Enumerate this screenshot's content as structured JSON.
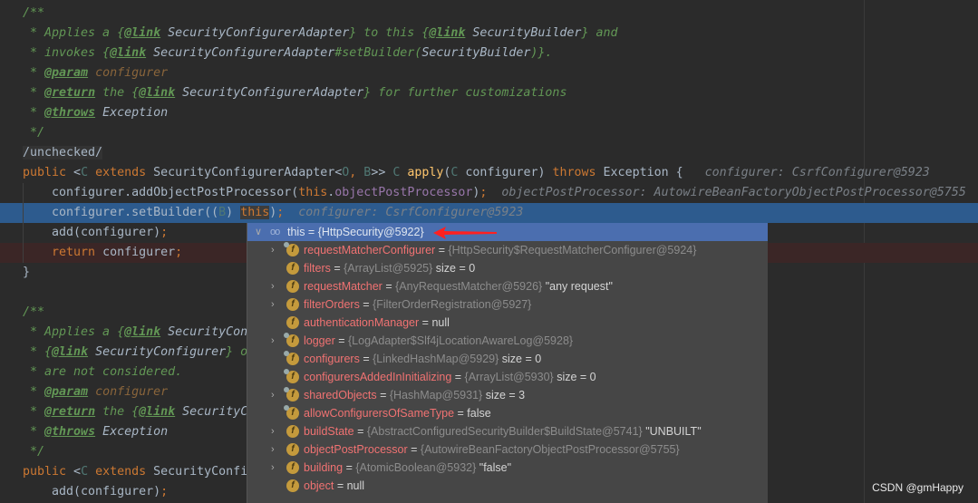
{
  "editor": {
    "lines": [
      [
        {
          "t": "/**",
          "c": "cm"
        }
      ],
      [
        {
          "t": " * Applies a {",
          "c": "cm"
        },
        {
          "t": "@link",
          "c": "tag"
        },
        {
          "t": " SecurityConfigurerAdapter",
          "c": "ref"
        },
        {
          "t": "} to this {",
          "c": "cm"
        },
        {
          "t": "@link",
          "c": "tag"
        },
        {
          "t": " SecurityBuilder",
          "c": "ref"
        },
        {
          "t": "} and",
          "c": "cm"
        }
      ],
      [
        {
          "t": " * invokes {",
          "c": "cm"
        },
        {
          "t": "@link",
          "c": "tag"
        },
        {
          "t": " SecurityConfigurerAdapter",
          "c": "ref"
        },
        {
          "t": "#setBuilder(",
          "c": "cm"
        },
        {
          "t": "SecurityBuilder",
          "c": "ref"
        },
        {
          "t": ")}.",
          "c": "cm"
        }
      ],
      [
        {
          "t": " * ",
          "c": "cm"
        },
        {
          "t": "@param",
          "c": "tag"
        },
        {
          "t": " configurer",
          "c": "pn"
        }
      ],
      [
        {
          "t": " * ",
          "c": "cm"
        },
        {
          "t": "@return",
          "c": "tag"
        },
        {
          "t": " the {",
          "c": "cm"
        },
        {
          "t": "@link",
          "c": "tag"
        },
        {
          "t": " SecurityConfigurerAdapter",
          "c": "ref"
        },
        {
          "t": "} for further customizations",
          "c": "cm"
        }
      ],
      [
        {
          "t": " * ",
          "c": "cm"
        },
        {
          "t": "@throws",
          "c": "tag"
        },
        {
          "t": " Exception",
          "c": "ref"
        }
      ],
      [
        {
          "t": " */",
          "c": "cm"
        }
      ],
      [
        {
          "t": "/unchecked/",
          "c": "unk"
        }
      ],
      [
        {
          "t": "public ",
          "c": "kw"
        },
        {
          "t": "<",
          "c": "pl"
        },
        {
          "t": "C ",
          "c": "ty"
        },
        {
          "t": "extends ",
          "c": "kw"
        },
        {
          "t": "SecurityConfigurerAdapter<",
          "c": "pl"
        },
        {
          "t": "O",
          "c": "ty"
        },
        {
          "t": ", ",
          "c": "kw"
        },
        {
          "t": "B",
          "c": "ty"
        },
        {
          "t": ">> ",
          "c": "pl"
        },
        {
          "t": "C ",
          "c": "ty"
        },
        {
          "t": "apply",
          "c": "fn"
        },
        {
          "t": "(",
          "c": "pl"
        },
        {
          "t": "C ",
          "c": "ty"
        },
        {
          "t": "configurer) ",
          "c": "pl"
        },
        {
          "t": "throws ",
          "c": "kw"
        },
        {
          "t": "Exception {",
          "c": "pl"
        },
        {
          "t": "   configurer: CsrfConfigurer@5923",
          "c": "hint"
        }
      ],
      [
        {
          "t": "    configurer.addObjectPostProcessor(",
          "c": "pl"
        },
        {
          "t": "this",
          "c": "kw"
        },
        {
          "t": ".",
          "c": "pl"
        },
        {
          "t": "objectPostProcessor",
          "c": "fld"
        },
        {
          "t": ")",
          "c": "pl"
        },
        {
          "t": ";",
          "c": "kw"
        },
        {
          "t": "  objectPostProcessor: AutowireBeanFactoryObjectPostProcessor@5755",
          "c": "hint"
        }
      ],
      [
        {
          "t": "    configurer.setBuilder((",
          "c": "pl"
        },
        {
          "t": "B",
          "c": "ty"
        },
        {
          "t": ") ",
          "c": "pl"
        },
        {
          "t": "this",
          "c": "thisbox"
        },
        {
          "t": ")",
          "c": "pl"
        },
        {
          "t": ";",
          "c": "kw"
        },
        {
          "t": "  configurer: CsrfConfigurer@5923",
          "c": "hint"
        }
      ],
      [
        {
          "t": "    add(configurer)",
          "c": "pl"
        },
        {
          "t": ";",
          "c": "kw"
        }
      ],
      [
        {
          "t": "    ",
          "c": "pl"
        },
        {
          "t": "return ",
          "c": "kw"
        },
        {
          "t": "configurer",
          "c": "pl"
        },
        {
          "t": ";",
          "c": "kw"
        }
      ],
      [
        {
          "t": "}",
          "c": "pl"
        }
      ],
      [],
      [
        {
          "t": "/**",
          "c": "cm"
        }
      ],
      [
        {
          "t": " * Applies a {",
          "c": "cm"
        },
        {
          "t": "@link",
          "c": "tag"
        },
        {
          "t": " SecurityCon",
          "c": "ref"
        }
      ],
      [
        {
          "t": " * {",
          "c": "cm"
        },
        {
          "t": "@link",
          "c": "tag"
        },
        {
          "t": " SecurityConfigurer",
          "c": "ref"
        },
        {
          "t": "} o",
          "c": "cm"
        }
      ],
      [
        {
          "t": " * are not considered.",
          "c": "cm"
        }
      ],
      [
        {
          "t": " * ",
          "c": "cm"
        },
        {
          "t": "@param",
          "c": "tag"
        },
        {
          "t": " configurer",
          "c": "pn"
        }
      ],
      [
        {
          "t": " * ",
          "c": "cm"
        },
        {
          "t": "@return",
          "c": "tag"
        },
        {
          "t": " the {",
          "c": "cm"
        },
        {
          "t": "@link",
          "c": "tag"
        },
        {
          "t": " SecurityC",
          "c": "ref"
        }
      ],
      [
        {
          "t": " * ",
          "c": "cm"
        },
        {
          "t": "@throws",
          "c": "tag"
        },
        {
          "t": " Exception",
          "c": "ref"
        }
      ],
      [
        {
          "t": " */",
          "c": "cm"
        }
      ],
      [
        {
          "t": "public ",
          "c": "kw"
        },
        {
          "t": "<",
          "c": "pl"
        },
        {
          "t": "C ",
          "c": "ty"
        },
        {
          "t": "extends ",
          "c": "kw"
        },
        {
          "t": "SecurityConfi",
          "c": "pl"
        }
      ],
      [
        {
          "t": "    add(configurer)",
          "c": "pl"
        },
        {
          "t": ";",
          "c": "kw"
        }
      ]
    ],
    "selected_line": 10,
    "breakpoint_line": 12
  },
  "debug_popup": {
    "header": {
      "expanded": true,
      "icon": "watch-glasses-icon",
      "text": "this = {HttpSecurity@5922}"
    },
    "rows": [
      {
        "expandable": true,
        "marker": true,
        "name": "requestMatcherConfigurer",
        "ref": "{HttpSecurity$RequestMatcherConfigurer@5924}",
        "extra": ""
      },
      {
        "expandable": false,
        "marker": false,
        "name": "filters",
        "ref": "{ArrayList@5925}",
        "extra": "size = 0"
      },
      {
        "expandable": true,
        "marker": false,
        "name": "requestMatcher",
        "ref": "{AnyRequestMatcher@5926}",
        "extra": "\"any request\""
      },
      {
        "expandable": true,
        "marker": false,
        "name": "filterOrders",
        "ref": "{FilterOrderRegistration@5927}",
        "extra": ""
      },
      {
        "expandable": false,
        "marker": false,
        "name": "authenticationManager",
        "ref": "",
        "extra": "null"
      },
      {
        "expandable": true,
        "marker": true,
        "name": "logger",
        "ref": "{LogAdapter$Slf4jLocationAwareLog@5928}",
        "extra": ""
      },
      {
        "expandable": false,
        "marker": true,
        "name": "configurers",
        "ref": "{LinkedHashMap@5929}",
        "extra": "size = 0"
      },
      {
        "expandable": false,
        "marker": true,
        "name": "configurersAddedInInitializing",
        "ref": "{ArrayList@5930}",
        "extra": "size = 0"
      },
      {
        "expandable": true,
        "marker": true,
        "name": "sharedObjects",
        "ref": "{HashMap@5931}",
        "extra": "size = 3"
      },
      {
        "expandable": false,
        "marker": true,
        "name": "allowConfigurersOfSameType",
        "ref": "",
        "extra": "false"
      },
      {
        "expandable": true,
        "marker": false,
        "name": "buildState",
        "ref": "{AbstractConfiguredSecurityBuilder$BuildState@5741}",
        "extra": "\"UNBUILT\""
      },
      {
        "expandable": true,
        "marker": false,
        "name": "objectPostProcessor",
        "ref": "{AutowireBeanFactoryObjectPostProcessor@5755}",
        "extra": ""
      },
      {
        "expandable": true,
        "marker": false,
        "name": "building",
        "ref": "{AtomicBoolean@5932}",
        "extra": "\"false\""
      },
      {
        "expandable": false,
        "marker": false,
        "name": "object",
        "ref": "",
        "extra": "null"
      }
    ],
    "field_icon_letter": "f"
  },
  "annotation_arrow_color": "#ff2020",
  "watermark": "CSDN @gmHappy"
}
